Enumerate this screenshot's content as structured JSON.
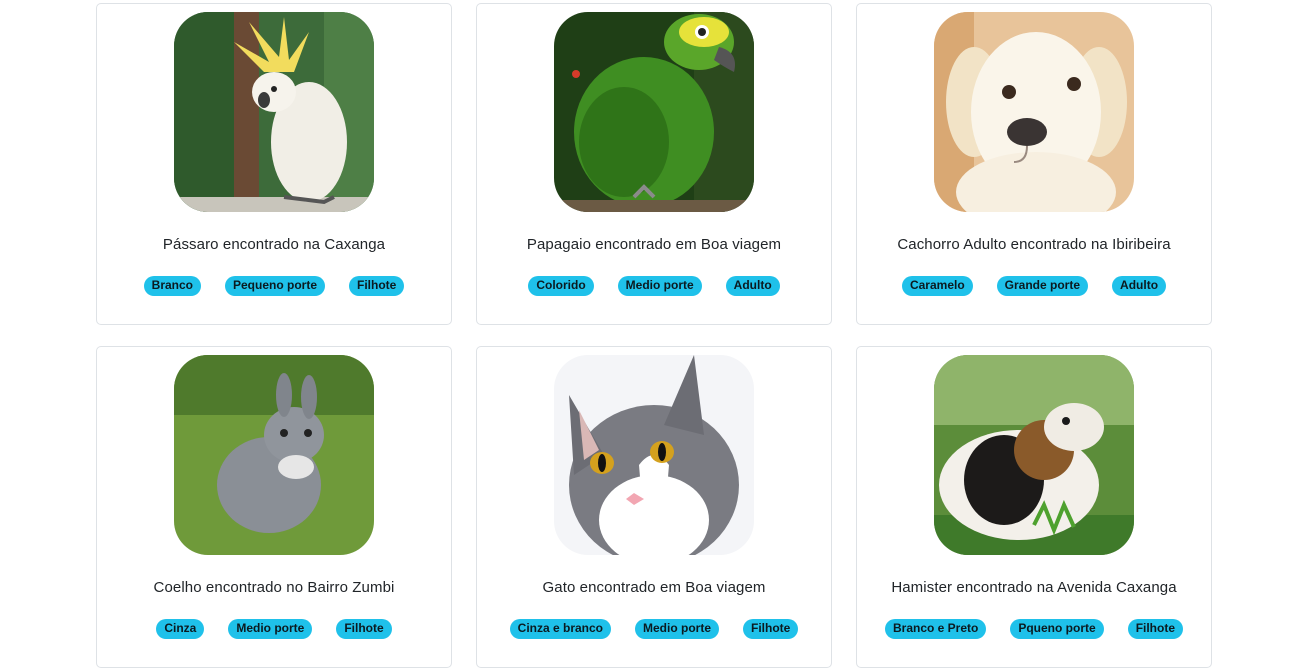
{
  "cards": [
    {
      "title": "Pássaro encontrado na Caxanga",
      "tags": [
        "Branco",
        "Pequeno porte",
        "Filhote"
      ],
      "image": "cockatoo"
    },
    {
      "title": "Papagaio encontrado em Boa viagem",
      "tags": [
        "Colorido",
        "Medio porte",
        "Adulto"
      ],
      "image": "green-parrot"
    },
    {
      "title": "Cachorro Adulto encontrado na Ibiribeira",
      "tags": [
        "Caramelo",
        "Grande porte",
        "Adulto"
      ],
      "image": "white-puppy"
    },
    {
      "title": "Coelho encontrado no Bairro Zumbi",
      "tags": [
        "Cinza",
        "Medio porte",
        "Filhote"
      ],
      "image": "grey-rabbit"
    },
    {
      "title": "Gato encontrado em Boa viagem",
      "tags": [
        "Cinza e branco",
        "Medio porte",
        "Filhote"
      ],
      "image": "grey-white-cat"
    },
    {
      "title": "Hamister encontrado na Avenida Caxanga",
      "tags": [
        "Branco e Preto",
        "Pqueno porte",
        "Filhote"
      ],
      "image": "guinea-pig"
    }
  ],
  "colors": {
    "tag_bg": "#1fc1ea",
    "border": "#dee2e6"
  }
}
